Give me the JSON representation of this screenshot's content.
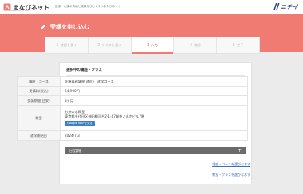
{
  "header": {
    "logo_text": "まなびネット",
    "logo_sub": "Manabi.net by Nichii",
    "tagline": "医療・介護の資格と実務をひとつずつまなびネット",
    "brand": "ニチイ"
  },
  "hero": {
    "title": "受講を申し込む"
  },
  "steps": [
    {
      "num": "1",
      "label": "確認を書く"
    },
    {
      "num": "2",
      "label": "クラスを選ぶ"
    },
    {
      "num": "3",
      "label": "入力"
    },
    {
      "num": "4",
      "label": "確認"
    },
    {
      "num": "5",
      "label": "完了"
    }
  ],
  "active_step": 3,
  "section": {
    "title": "選択中の講座・クラス"
  },
  "info": {
    "course_label": "講座・コース",
    "course_value": "医療事務講座(通科)　通学コース",
    "fee_label": "受講料(税込)",
    "fee_value": "64,900円",
    "period_label": "受講期間(目安)",
    "period_value": "3ヵ月",
    "room_label": "教室",
    "room_name": "お茶の水教室",
    "room_address": "東京都千代田区神田駿河台2-1-47御茶ノ水ホビル7階",
    "map_button": "Google MAPで見る",
    "start_label": "通学開始日",
    "start_value": "2024/7/3"
  },
  "accordion": {
    "label": "日程詳細",
    "icon": "plus-icon"
  },
  "links": {
    "course_change": "講座・コースを選びなおす",
    "class_change": "教室・クラスを選びなおす"
  },
  "colors": {
    "accent": "#f07b73",
    "brand": "#2a3f94",
    "link": "#3d6fbf"
  }
}
